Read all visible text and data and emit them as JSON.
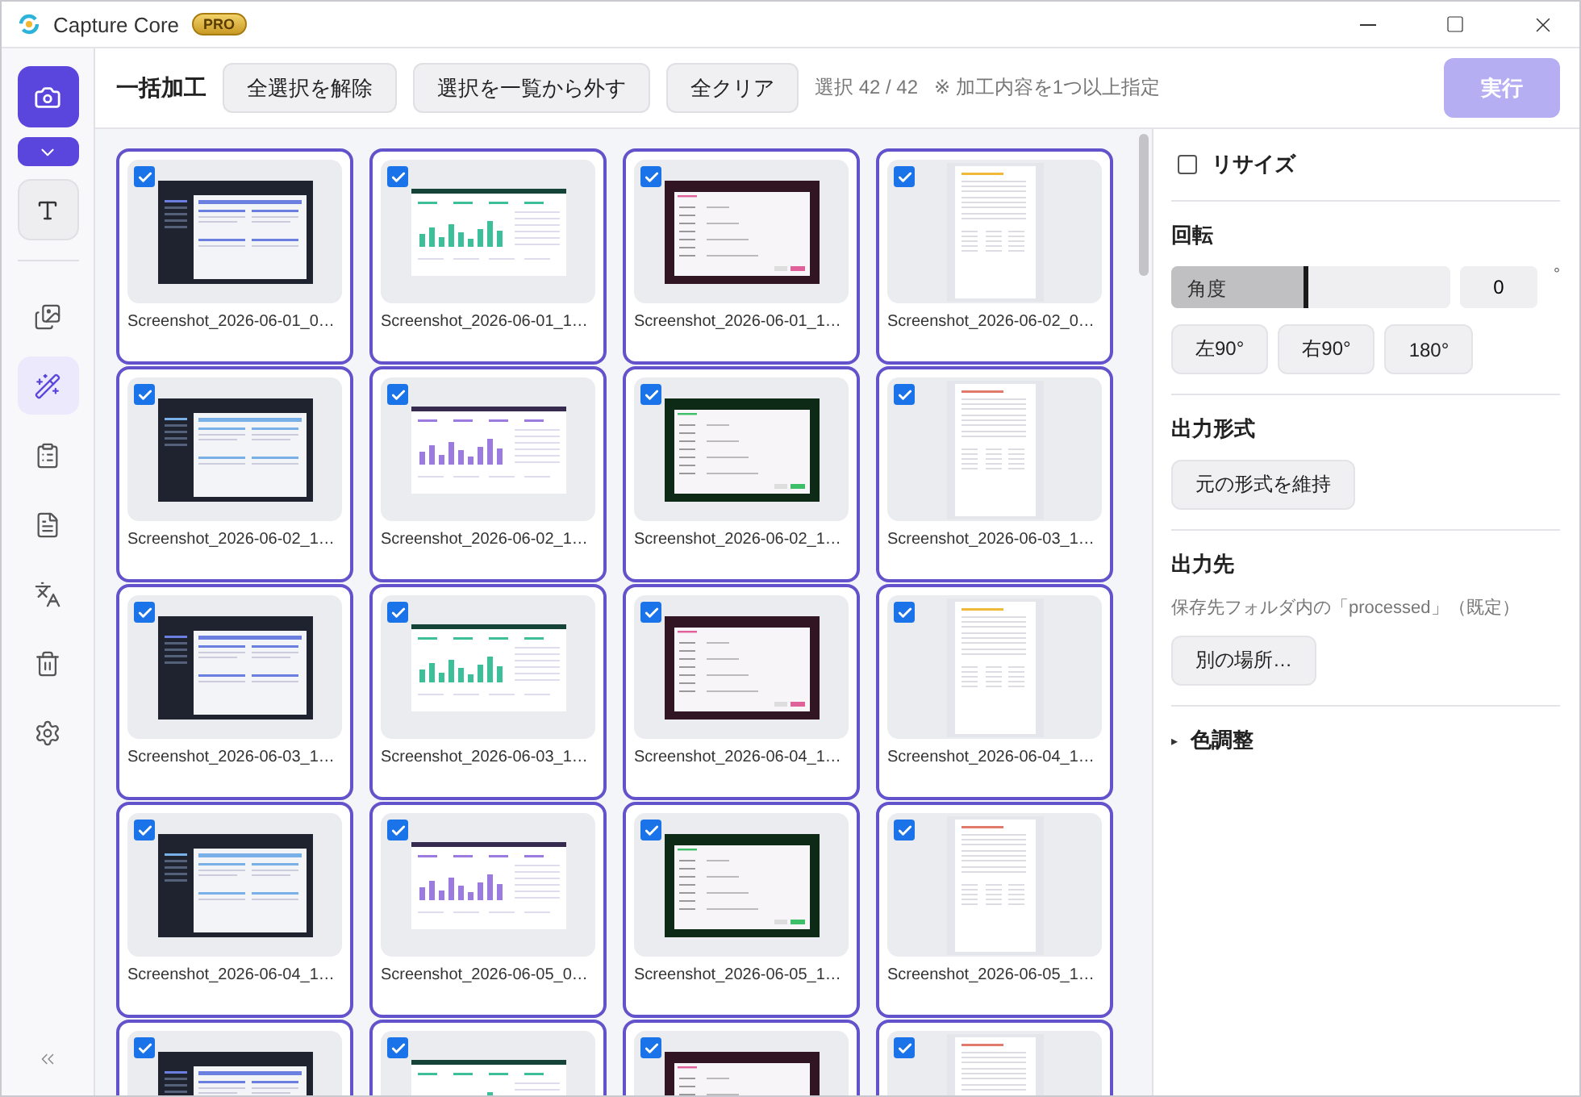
{
  "window": {
    "title": "Capture Core",
    "badge": "PRO"
  },
  "sidebar": {
    "tools": [
      {
        "selected": false
      },
      {
        "selected": true
      },
      {
        "selected": false
      },
      {
        "selected": false
      },
      {
        "selected": false
      },
      {
        "selected": false
      },
      {
        "selected": false
      }
    ]
  },
  "toolbar": {
    "title": "一括加工",
    "buttons": [
      "全選択を解除",
      "選択を一覧から外す",
      "全クリア"
    ],
    "selection": "選択 42 / 42",
    "hint": "※ 加工内容を1つ以上指定",
    "run": {
      "label": "実行",
      "disabled": true
    }
  },
  "files": [
    {
      "name": "Screenshot_2026-06-01_0…",
      "checked": true,
      "kind": "app",
      "color": "#6b7fe0"
    },
    {
      "name": "Screenshot_2026-06-01_1…",
      "checked": true,
      "kind": "chart",
      "color": "#3dbf9a"
    },
    {
      "name": "Screenshot_2026-06-01_1…",
      "checked": true,
      "kind": "form",
      "color": "#e0609a"
    },
    {
      "name": "Screenshot_2026-06-02_0…",
      "checked": true,
      "kind": "doc",
      "color": "#f0b93a"
    },
    {
      "name": "Screenshot_2026-06-02_1…",
      "checked": true,
      "kind": "app",
      "color": "#7ab0e8"
    },
    {
      "name": "Screenshot_2026-06-02_1…",
      "checked": true,
      "kind": "chart",
      "color": "#9b7be0"
    },
    {
      "name": "Screenshot_2026-06-02_1…",
      "checked": true,
      "kind": "form",
      "color": "#3dbf6a"
    },
    {
      "name": "Screenshot_2026-06-03_1…",
      "checked": true,
      "kind": "doc",
      "color": "#e07b6b"
    },
    {
      "name": "Screenshot_2026-06-03_1…",
      "checked": true,
      "kind": "app",
      "color": "#6b7fe0"
    },
    {
      "name": "Screenshot_2026-06-03_1…",
      "checked": true,
      "kind": "chart",
      "color": "#3dbf9a"
    },
    {
      "name": "Screenshot_2026-06-04_1…",
      "checked": true,
      "kind": "form",
      "color": "#e0609a"
    },
    {
      "name": "Screenshot_2026-06-04_1…",
      "checked": true,
      "kind": "doc",
      "color": "#f0b93a"
    },
    {
      "name": "Screenshot_2026-06-04_1…",
      "checked": true,
      "kind": "app",
      "color": "#7ab0e8"
    },
    {
      "name": "Screenshot_2026-06-05_0…",
      "checked": true,
      "kind": "chart",
      "color": "#9b7be0"
    },
    {
      "name": "Screenshot_2026-06-05_1…",
      "checked": true,
      "kind": "form",
      "color": "#3dbf6a"
    },
    {
      "name": "Screenshot_2026-06-05_1…",
      "checked": true,
      "kind": "doc",
      "color": "#e07b6b"
    },
    {
      "checked": true,
      "kind": "app",
      "color": "#6b7fe0"
    },
    {
      "checked": true,
      "kind": "chart",
      "color": "#3dbf9a"
    },
    {
      "checked": true,
      "kind": "form",
      "color": "#e0609a"
    },
    {
      "checked": true,
      "kind": "doc",
      "color": "#e07b6b"
    }
  ],
  "panel": {
    "resize": {
      "label": "リサイズ",
      "checked": false
    },
    "rotation": {
      "heading": "回転",
      "slider_label": "角度",
      "level": 0.49,
      "value": "0",
      "unit": "°",
      "buttons": [
        "左90°",
        "右90°",
        "180°"
      ]
    },
    "format": {
      "heading": "出力形式",
      "button": "元の形式を維持"
    },
    "output": {
      "heading": "出力先",
      "note": "保存先フォルダ内の「processed」（既定）",
      "button": "別の場所…"
    },
    "color_adjust": {
      "marker": "▸",
      "label": "色調整",
      "expanded": false
    }
  }
}
